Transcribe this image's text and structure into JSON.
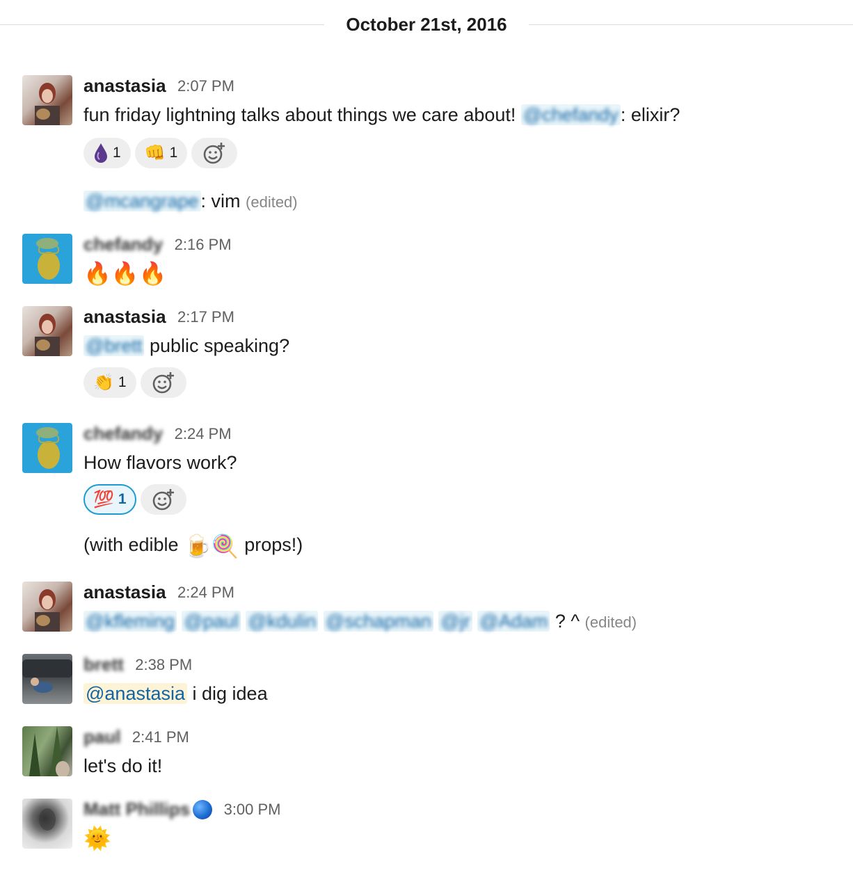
{
  "date_divider": "October 21st, 2016",
  "messages": [
    {
      "author": "anastasia",
      "time": "2:07 PM",
      "text_before": "fun friday lightning talks about things we care about! ",
      "mention": "@chefandy",
      "text_after": ": elixir?",
      "reactions": [
        {
          "emoji": "💧",
          "count": "1",
          "icon": "elixir-drop-icon"
        },
        {
          "emoji": "👊",
          "count": "1",
          "icon": "fist-bump-icon"
        }
      ]
    },
    {
      "mention": "@mcangrape",
      "text_after": ": vim",
      "edited": "(edited)"
    },
    {
      "author": "chefandy",
      "time": "2:16 PM",
      "text": "🔥🔥🔥"
    },
    {
      "author": "anastasia",
      "time": "2:17 PM",
      "mention": "@brett",
      "text_after": " public speaking?",
      "reactions": [
        {
          "emoji": "👏",
          "count": "1",
          "icon": "clap-icon"
        }
      ]
    },
    {
      "author": "chefandy",
      "time": "2:24 PM",
      "text": "How flavors work?",
      "reactions": [
        {
          "emoji": "💯",
          "count": "1",
          "icon": "hundred-points-icon",
          "active": true
        }
      ]
    },
    {
      "text_before": "(with edible ",
      "emojis": "🍺🍭",
      "text_after": " props!)"
    },
    {
      "author": "anastasia",
      "time": "2:24 PM",
      "mentions": [
        "@kfleming",
        "@paul",
        "@kdulin",
        "@schapman",
        "@jr",
        "@Adam"
      ],
      "text_after": " ? ^ ",
      "edited": "(edited)"
    },
    {
      "author": "brett",
      "time": "2:38 PM",
      "mention": "@anastasia",
      "text_after": " i dig idea"
    },
    {
      "author": "paul",
      "time": "2:41 PM",
      "text": "let's do it!"
    },
    {
      "author": "Matt Phillips",
      "time": "3:00 PM",
      "text": "🌞"
    }
  ],
  "colors": {
    "mention": "#1264a3",
    "mention_bg": "#e8f5fa",
    "self_mention_bg": "#fdf3d6",
    "reaction_active_border": "#1d9bd1"
  }
}
